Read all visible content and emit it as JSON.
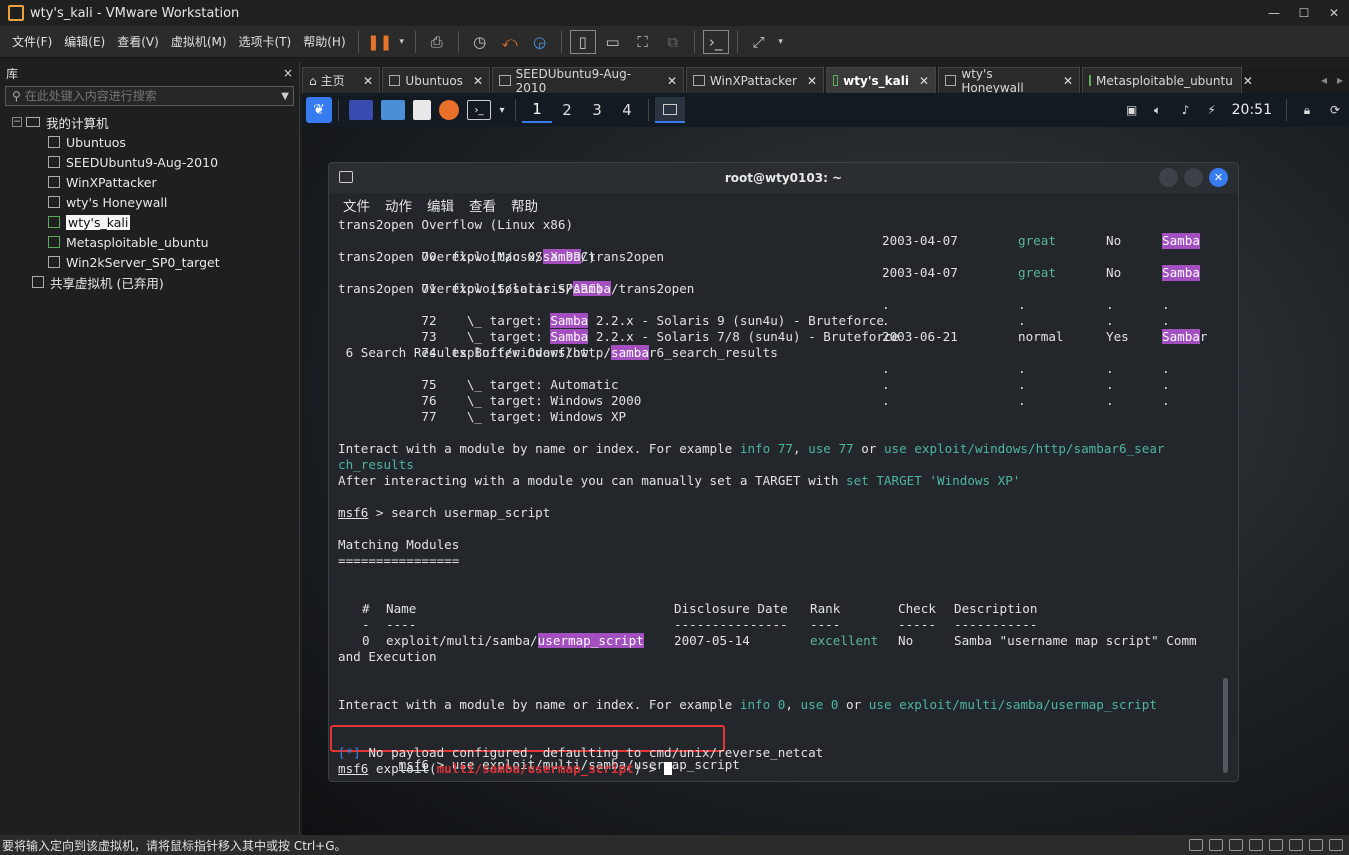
{
  "window": {
    "title": "wty's_kali - VMware Workstation"
  },
  "menubar": {
    "items": [
      "文件(F)",
      "编辑(E)",
      "查看(V)",
      "虚拟机(M)",
      "选项卡(T)",
      "帮助(H)"
    ]
  },
  "library": {
    "title": "库",
    "close": "×",
    "search_placeholder": "在此处键入内容进行搜索",
    "root": "我的计算机",
    "vms": [
      {
        "name": "Ubuntuos",
        "running": false
      },
      {
        "name": "SEEDUbuntu9-Aug-2010",
        "running": false
      },
      {
        "name": "WinXPattacker",
        "running": false
      },
      {
        "name": "wty's Honeywall",
        "running": false
      },
      {
        "name": "wty's_kali",
        "running": true
      },
      {
        "name": "Metasploitable_ubuntu",
        "running": true
      },
      {
        "name": "Win2kServer_SP0_target",
        "running": false
      }
    ],
    "shared": "共享虚拟机 (已弃用)"
  },
  "tabs": [
    {
      "label": "主页"
    },
    {
      "label": "Ubuntuos"
    },
    {
      "label": "SEEDUbuntu9-Aug-2010"
    },
    {
      "label": "WinXPattacker"
    },
    {
      "label": "wty's_kali"
    },
    {
      "label": "wty's Honeywall"
    },
    {
      "label": "Metasploitable_ubuntu"
    }
  ],
  "kali_panel": {
    "workspaces": [
      "1",
      "2",
      "3",
      "4"
    ],
    "clock": "20:51"
  },
  "terminal": {
    "title": "root@wty0103: ~",
    "menu": [
      "文件",
      "动作",
      "编辑",
      "查看",
      "帮助"
    ],
    "results": {
      "r0_text": "trans2open Overflow (Linux x86)",
      "r70_idx": "   70  exploit/osx/",
      "r70_hl": "samba",
      "r70_rest": "/trans2open",
      "r70_date": "2003-04-07",
      "r70_rank": "great",
      "r70_check": "No",
      "r70_desc": "Samba",
      "r1_text": "trans2open Overflow (Mac OS X PPC)",
      "r71_idx": "   71  exploit/solaris/",
      "r71_hl": "samba",
      "r71_rest": "/trans2open",
      "r71_date": "2003-04-07",
      "r71_rank": "great",
      "r71_check": "No",
      "r71_desc": "Samba",
      "r2_text": "trans2open Overflow (Solaris SPARC)",
      "r72_pre": "   72    \\_ target: ",
      "r72_hl": "Samba",
      "r72_rest": " 2.2.x - Solaris 9 (sun4u) - Bruteforce",
      "r73_pre": "   73    \\_ target: ",
      "r73_hl": "Samba",
      "r73_rest": " 2.2.x - Solaris 7/8 (sun4u) - Bruteforce",
      "r74_pre": "   74  exploit/windows/http/",
      "r74_hl": "samba",
      "r74_rest": "r6_search_results",
      "r74_date": "2003-06-21",
      "r74_rank": "normal",
      "r74_check": "Yes",
      "r74_desc_hl": "Samba",
      "r74_desc_rest": "r",
      "r3_text": " 6 Search Results Buffer Overflow",
      "r75": "   75    \\_ target: Automatic",
      "r76": "   76    \\_ target: Windows 2000",
      "r77": "   77    \\_ target: Windows XP",
      "dot": "."
    },
    "interact1": {
      "pre": "Interact with a module by name or index. For example ",
      "info": "info 77",
      "comma": ", ",
      "use": "use 77",
      "or": " or ",
      "use_path": "use exploit/windows/http/sambar6_sear",
      "cont": "ch_results"
    },
    "after": {
      "pre": "After interacting with a module you can manually set a TARGET with ",
      "cmd": "set TARGET 'Windows XP'"
    },
    "prompt": "msf6",
    "cmd_search": " > search usermap_script",
    "matching_modules": "Matching Modules",
    "matching_underline": "================",
    "table_header": {
      "hash": "#",
      "name": "Name",
      "date": "Disclosure Date",
      "rank": "Rank",
      "check": "Check",
      "desc": "Description"
    },
    "table_underline": {
      "hash": "-",
      "name": "----",
      "date": "---------------",
      "rank": "----",
      "check": "-----",
      "desc": "-----------"
    },
    "row0": {
      "idx": "0",
      "path_pre": "exploit/multi/samba/",
      "path_hl": "usermap_script",
      "date": "2007-05-14",
      "rank": "excellent",
      "check": "No",
      "desc": "Samba \"username map script\" Comm",
      "cont": "and Execution"
    },
    "interact2": {
      "pre": "Interact with a module by name or index. For example ",
      "info": "info 0",
      "comma": ", ",
      "use": "use 0",
      "or": " or ",
      "use_path": "use exploit/multi/samba/usermap_script"
    },
    "cmd_use": " > use exploit/multi/samba/usermap_script",
    "payload_tag": "[*]",
    "payload_msg": " No payload configured, defaulting to cmd/unix/reverse_netcat",
    "final_prompt_mid": " exploit(",
    "final_module": "multi/samba/usermap_script",
    "final_prompt_end": ") > "
  },
  "statusbar": {
    "text": "要将输入定向到该虚拟机，请将鼠标指针移入其中或按 Ctrl+G。"
  },
  "colors": {
    "kali_blue": "#367bf0",
    "highlight_purple": "#a34fbf",
    "annotation_red": "#e53434",
    "pause_orange": "#e8742a"
  }
}
